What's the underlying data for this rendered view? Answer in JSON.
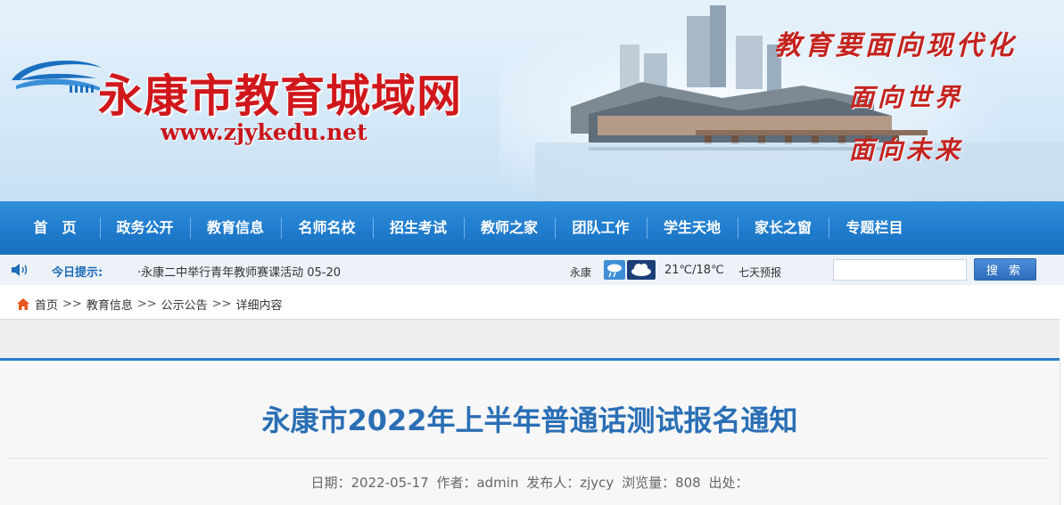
{
  "header": {
    "site_title": "永康市教育城域网",
    "site_url": "www.zjykedu.net",
    "slogans": [
      "教育要面向现代化",
      "面向世界",
      "面向未来"
    ]
  },
  "nav": {
    "items": [
      {
        "label": "首　页"
      },
      {
        "label": "政务公开"
      },
      {
        "label": "教育信息"
      },
      {
        "label": "名师名校"
      },
      {
        "label": "招生考试"
      },
      {
        "label": "教师之家"
      },
      {
        "label": "团队工作"
      },
      {
        "label": "学生天地"
      },
      {
        "label": "家长之窗"
      },
      {
        "label": "专题栏目"
      }
    ]
  },
  "infobar": {
    "tips_label": "今日提示:",
    "tips_text": "·永康二中举行青年教师赛课活动 05-20",
    "weather": {
      "city": "永康",
      "temperature": "21℃/18℃",
      "forecast_link": "七天预报",
      "icons": [
        "rain-icon",
        "cloudy-icon"
      ]
    },
    "search": {
      "placeholder": "",
      "button_label": "搜 索"
    }
  },
  "breadcrumb": {
    "items": [
      "首页",
      "教育信息",
      "公示公告",
      "详细内容"
    ],
    "separator": ">>"
  },
  "article": {
    "title": "永康市2022年上半年普通话测试报名通知",
    "meta": {
      "date": "日期：2022-05-17",
      "author": "作者：admin",
      "publisher": "发布人：zjycy",
      "views": "浏览量：808",
      "source": "出处："
    }
  },
  "colors": {
    "nav_blue": "#1f7acb",
    "title_red": "#d0181c",
    "article_title_blue": "#2a6fb5"
  }
}
